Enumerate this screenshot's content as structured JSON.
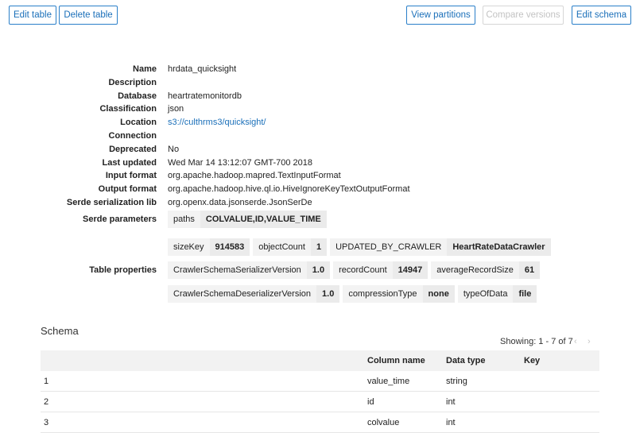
{
  "toolbar": {
    "edit_table": "Edit table",
    "delete_table": "Delete table",
    "view_partitions": "View partitions",
    "compare_versions": "Compare versions",
    "edit_schema": "Edit schema"
  },
  "details": [
    {
      "label": "Name",
      "value": "hrdata_quicksight"
    },
    {
      "label": "Description",
      "value": ""
    },
    {
      "label": "Database",
      "value": "heartratemonitordb"
    },
    {
      "label": "Classification",
      "value": "json"
    },
    {
      "label": "Location",
      "value": "s3://culthrms3/quicksight/"
    },
    {
      "label": "Connection",
      "value": ""
    },
    {
      "label": "Deprecated",
      "value": "No"
    },
    {
      "label": "Last updated",
      "value": "Wed Mar 14 13:12:07 GMT-700 2018"
    },
    {
      "label": "Input format",
      "value": "org.apache.hadoop.mapred.TextInputFormat"
    },
    {
      "label": "Output format",
      "value": "org.apache.hadoop.hive.ql.io.HiveIgnoreKeyTextOutputFormat"
    },
    {
      "label": "Serde serialization lib",
      "value": "org.openx.data.jsonserde.JsonSerDe"
    }
  ],
  "serde_parameters": {
    "label": "Serde parameters",
    "items": [
      {
        "key": "paths",
        "value": "COLVALUE,ID,VALUE_TIME"
      }
    ]
  },
  "table_properties": {
    "label": "Table properties",
    "items": [
      {
        "key": "sizeKey",
        "value": "914583"
      },
      {
        "key": "objectCount",
        "value": "1"
      },
      {
        "key": "UPDATED_BY_CRAWLER",
        "value": "HeartRateDataCrawler"
      },
      {
        "key": "CrawlerSchemaSerializerVersion",
        "value": "1.0"
      },
      {
        "key": "recordCount",
        "value": "14947"
      },
      {
        "key": "averageRecordSize",
        "value": "61"
      },
      {
        "key": "CrawlerSchemaDeserializerVersion",
        "value": "1.0"
      },
      {
        "key": "compressionType",
        "value": "none"
      },
      {
        "key": "typeOfData",
        "value": "file"
      }
    ]
  },
  "schema": {
    "title": "Schema",
    "showing": "Showing: 1 - 7 of 7",
    "prev_icon": "‹",
    "next_icon": "›",
    "columns": [
      "Column name",
      "Data type",
      "Key"
    ],
    "rows": [
      {
        "num": "1",
        "name": "value_time",
        "type": "string",
        "key": ""
      },
      {
        "num": "2",
        "name": "id",
        "type": "int",
        "key": ""
      },
      {
        "num": "3",
        "name": "colvalue",
        "type": "int",
        "key": ""
      }
    ]
  }
}
